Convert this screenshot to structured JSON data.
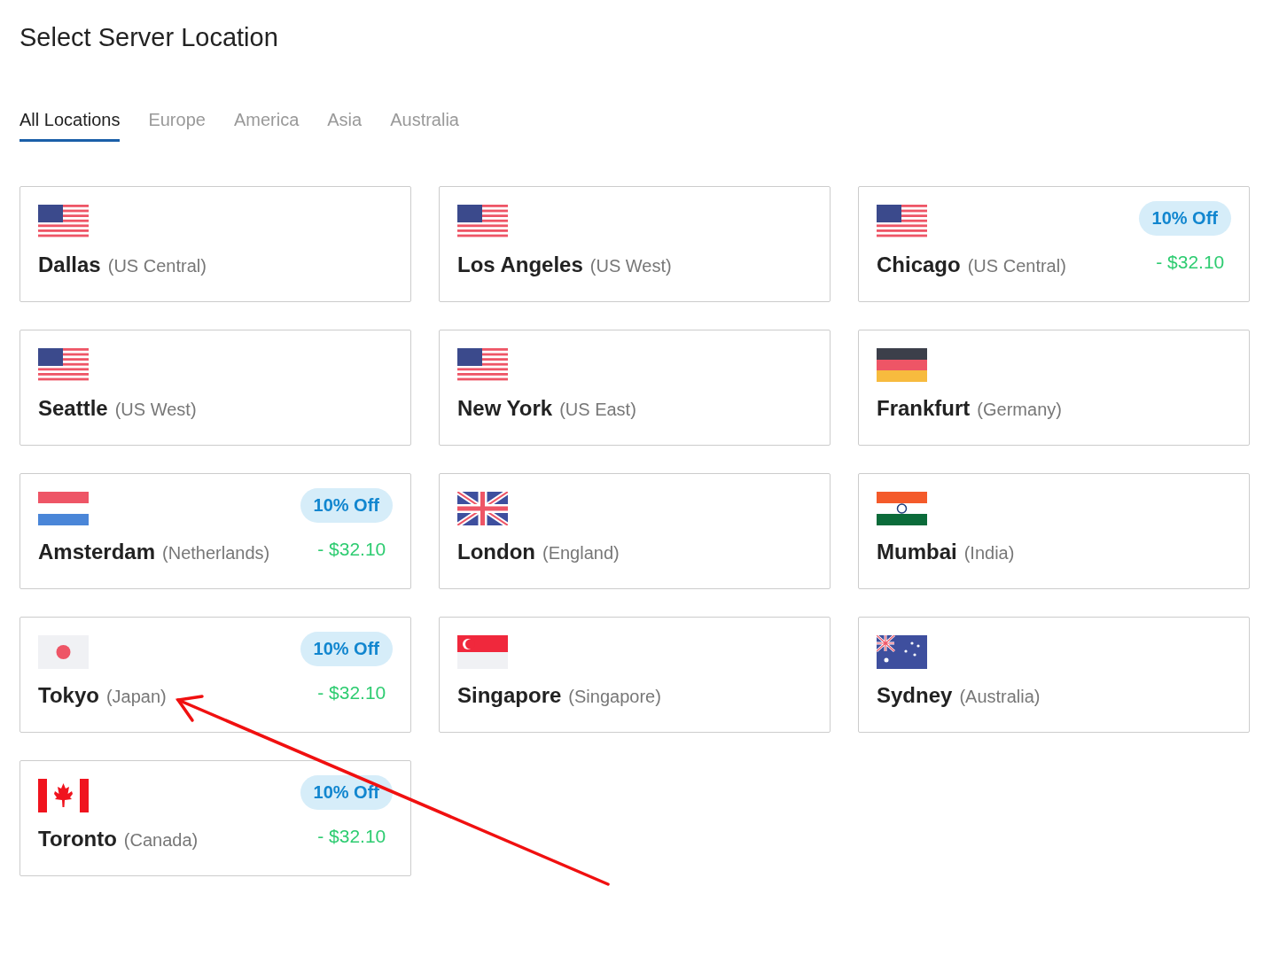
{
  "title": "Select Server Location",
  "tabs": [
    {
      "label": "All Locations",
      "selected": true
    },
    {
      "label": "Europe",
      "selected": false
    },
    {
      "label": "America",
      "selected": false
    },
    {
      "label": "Asia",
      "selected": false
    },
    {
      "label": "Australia",
      "selected": false
    }
  ],
  "locations": [
    {
      "city": "Dallas",
      "region": "(US Central)",
      "kind": "us"
    },
    {
      "city": "Los Angeles",
      "region": "(US West)",
      "kind": "us"
    },
    {
      "city": "Chicago",
      "region": "(US Central)",
      "kind": "us",
      "badge": "10% Off",
      "price": "- $32.10"
    },
    {
      "city": "Seattle",
      "region": "(US West)",
      "kind": "us"
    },
    {
      "city": "New York",
      "region": "(US East)",
      "kind": "us"
    },
    {
      "city": "Frankfurt",
      "region": "(Germany)",
      "kind": "de"
    },
    {
      "city": "Amsterdam",
      "region": "(Netherlands)",
      "kind": "nl",
      "badge": "10% Off",
      "price": "- $32.10"
    },
    {
      "city": "London",
      "region": "(England)",
      "kind": "uk"
    },
    {
      "city": "Mumbai",
      "region": "(India)",
      "kind": "in"
    },
    {
      "city": "Tokyo",
      "region": "(Japan)",
      "kind": "jp",
      "badge": "10% Off",
      "price": "- $32.10"
    },
    {
      "city": "Singapore",
      "region": "(Singapore)",
      "kind": "sg"
    },
    {
      "city": "Sydney",
      "region": "(Australia)",
      "kind": "au"
    },
    {
      "city": "Toronto",
      "region": "(Canada)",
      "kind": "ca",
      "badge": "10% Off",
      "price": "- $32.10"
    }
  ],
  "annotation": {
    "kind": "arrow"
  }
}
